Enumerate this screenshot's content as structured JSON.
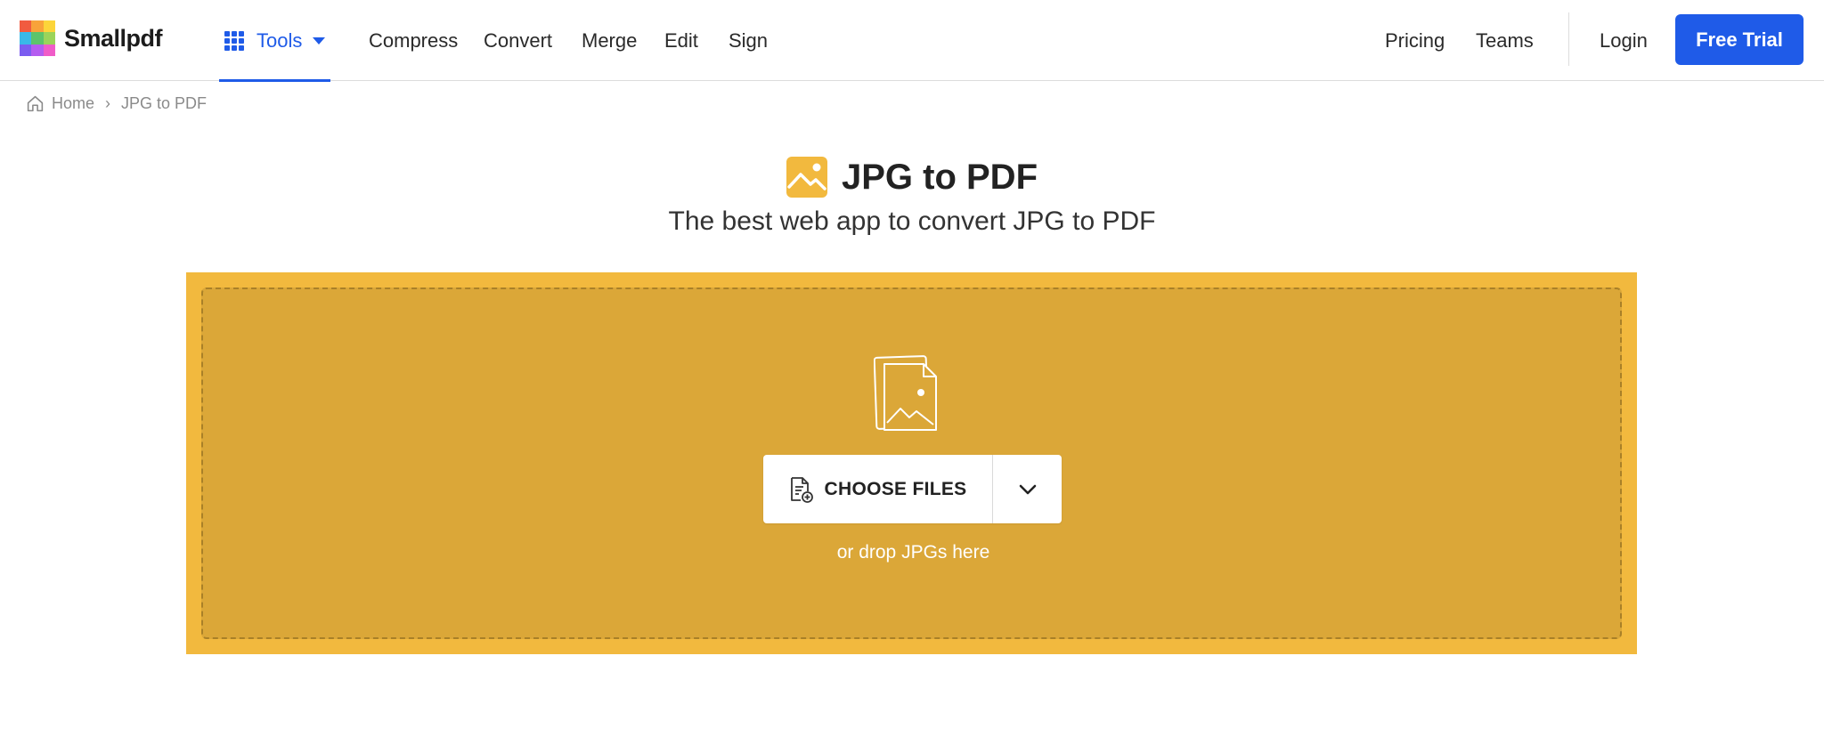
{
  "brand": {
    "name": "Smallpdf",
    "logo_colors": [
      "#f15b40",
      "#f8a33a",
      "#fcd53a",
      "#39b8e8",
      "#5cc46b",
      "#9bd45a",
      "#7b5cf0",
      "#b45cf0",
      "#f05cc8"
    ]
  },
  "header": {
    "tools_label": "Tools",
    "nav": [
      "Compress",
      "Convert",
      "Merge",
      "Edit",
      "Sign"
    ],
    "right_nav": [
      "Pricing",
      "Teams"
    ],
    "login_label": "Login",
    "trial_label": "Free Trial",
    "accent_color": "#1f5be8"
  },
  "breadcrumb": {
    "home": "Home",
    "separator": "›",
    "current": "JPG to PDF"
  },
  "page": {
    "title": "JPG to PDF",
    "subtitle": "The best web app to convert JPG to PDF"
  },
  "dropzone": {
    "choose_label": "CHOOSE FILES",
    "hint": "or drop JPGs here",
    "outer_color": "#f2b93e",
    "inner_color": "#dba738"
  }
}
